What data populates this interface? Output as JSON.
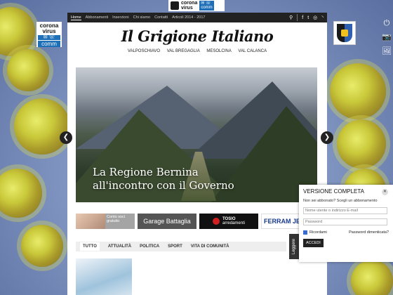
{
  "badge": {
    "corona": "corona",
    "virus": "virus",
    "comm": "comm"
  },
  "nav": {
    "items": [
      {
        "label": "Home",
        "active": true
      },
      {
        "label": "Abbonamenti",
        "active": false
      },
      {
        "label": "Inserzioni",
        "active": false
      },
      {
        "label": "Chi siamo",
        "active": false
      },
      {
        "label": "Contatti",
        "active": false
      },
      {
        "label": "Articoli 2014 - 2017",
        "active": false
      }
    ],
    "icons": [
      "search-icon",
      "facebook-icon",
      "twitter-icon",
      "instagram-icon",
      "rss-icon"
    ]
  },
  "masthead": {
    "logo": "Il Grigione Italiano",
    "regions": [
      "VALPOSCHIAVO",
      "VAL BREGAGLIA",
      "MESOLCINA",
      "VAL CALANCA"
    ]
  },
  "slider": {
    "headline_line1": "La Regione Bernina",
    "headline_line2": "all'incontro con il Governo"
  },
  "ads": {
    "ad1": "Conto soci gratuito",
    "ad2": "Garage Battaglia",
    "ad3_brand": "TOSIO",
    "ad3_sub": "arredamenti",
    "ad4": "FERRAM JEN"
  },
  "tabs": [
    "TUTTO",
    "ATTUALITÀ",
    "POLITICA",
    "SPORT",
    "VITA DI COMUNITÀ"
  ],
  "side_tab": "Leggere",
  "login": {
    "title": "VERSIONE COMPLETA",
    "subtitle": "Non sei abbonato? Scegli un abbonamento",
    "username_placeholder": "Nome utente o indirizzo E-mail",
    "password_placeholder": "Password",
    "remember": "Ricordami",
    "forgot": "Password dimenticata?",
    "submit": "ACCEDI"
  }
}
